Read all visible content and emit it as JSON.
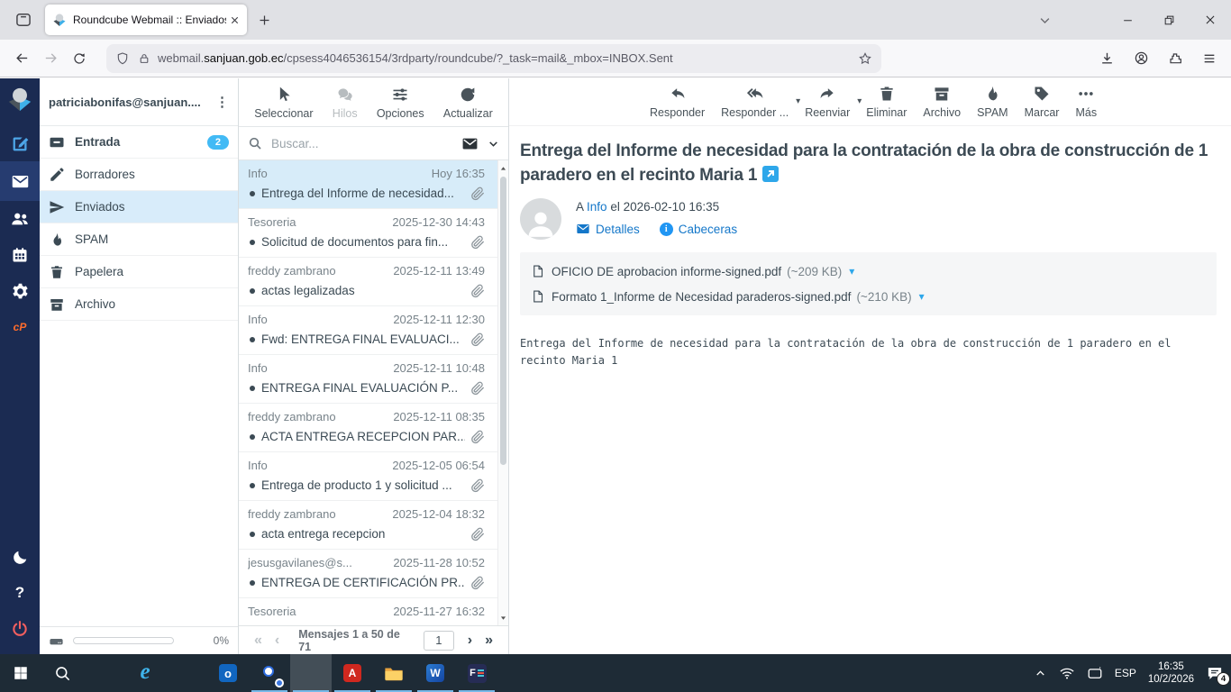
{
  "browser": {
    "tab_title": "Roundcube Webmail :: Enviados",
    "url_host_prefix": "webmail.",
    "url_domain": "sanjuan.gob.ec",
    "url_path": "/cpsess4046536154/3rdparty/roundcube/?_task=mail&_mbox=INBOX.Sent"
  },
  "account": {
    "email": "patriciabonifas@sanjuan...."
  },
  "folders": [
    {
      "label": "Entrada",
      "icon": "inbox",
      "badge": "2",
      "bold": true
    },
    {
      "label": "Borradores",
      "icon": "pencil"
    },
    {
      "label": "Enviados",
      "icon": "send",
      "selected": true
    },
    {
      "label": "SPAM",
      "icon": "flame"
    },
    {
      "label": "Papelera",
      "icon": "trash"
    },
    {
      "label": "Archivo",
      "icon": "archive"
    }
  ],
  "quota": {
    "percent": "0%"
  },
  "list_toolbar": [
    {
      "label": "Seleccionar",
      "icon": "pointer"
    },
    {
      "label": "Hilos",
      "icon": "chat",
      "disabled": true
    },
    {
      "label": "Opciones",
      "icon": "sliders"
    },
    {
      "label": "Actualizar",
      "icon": "refresh"
    }
  ],
  "search": {
    "placeholder": "Buscar..."
  },
  "messages": [
    {
      "sender": "Info",
      "date": "Hoy 16:35",
      "subject": "Entrega del Informe de necesidad...",
      "attachment": true,
      "selected": true
    },
    {
      "sender": "Tesoreria",
      "date": "2025-12-30 14:43",
      "subject": "Solicitud de documentos para fin...",
      "attachment": true
    },
    {
      "sender": "freddy zambrano",
      "date": "2025-12-11 13:49",
      "subject": "actas legalizadas",
      "attachment": true
    },
    {
      "sender": "Info",
      "date": "2025-12-11 12:30",
      "subject": "Fwd: ENTREGA FINAL EVALUACI...",
      "attachment": true
    },
    {
      "sender": "Info",
      "date": "2025-12-11 10:48",
      "subject": "ENTREGA FINAL EVALUACIÓN P...",
      "attachment": true
    },
    {
      "sender": "freddy zambrano",
      "date": "2025-12-11 08:35",
      "subject": "ACTA ENTREGA RECEPCION PAR...",
      "attachment": true
    },
    {
      "sender": "Info",
      "date": "2025-12-05 06:54",
      "subject": "Entrega de producto 1 y solicitud ...",
      "attachment": true
    },
    {
      "sender": "freddy zambrano",
      "date": "2025-12-04 18:32",
      "subject": "acta entrega recepcion",
      "attachment": true
    },
    {
      "sender": "jesusgavilanes@s...",
      "date": "2025-11-28 10:52",
      "subject": "ENTREGA DE CERTIFICACIÓN PR...",
      "attachment": true
    },
    {
      "sender": "Tesoreria",
      "date": "2025-11-27 16:32"
    }
  ],
  "pager": {
    "label": "Mensajes 1 a 50 de 71",
    "page": "1"
  },
  "mail_toolbar": [
    {
      "label": "Responder",
      "icon": "reply"
    },
    {
      "label": "Responder ...",
      "icon": "replyall",
      "caret": true
    },
    {
      "label": "Reenviar",
      "icon": "forward",
      "caret": true
    },
    {
      "label": "Eliminar",
      "icon": "trash"
    },
    {
      "label": "Archivo",
      "icon": "archive"
    },
    {
      "label": "SPAM",
      "icon": "flame"
    },
    {
      "label": "Marcar",
      "icon": "tag"
    },
    {
      "label": "Más",
      "icon": "more"
    }
  ],
  "message": {
    "subject": "Entrega del Informe de necesidad para la contratación de la obra de construcción de 1 paradero en el recinto Maria 1",
    "to_prefix": "A",
    "to": "Info",
    "date_text": "el 2026-02-10 16:35",
    "details_label": "Detalles",
    "headers_label": "Cabeceras",
    "attachments": [
      {
        "name": "OFICIO DE aprobacion informe-signed.pdf",
        "size": "(~209 KB)"
      },
      {
        "name": "Formato 1_Informe de Necesidad paraderos-signed.pdf",
        "size": "(~210 KB)"
      }
    ],
    "body": "Entrega del Informe de necesidad para la contratación de la obra de construcción de 1 paradero en el recinto Maria 1"
  },
  "taskbar": {
    "apps": [
      {
        "name": "start"
      },
      {
        "name": "taskbar-search"
      },
      {
        "name": "copilot"
      },
      {
        "name": "internet-explorer"
      },
      {
        "name": "edge"
      },
      {
        "name": "outlook"
      },
      {
        "name": "chrome",
        "running": true
      },
      {
        "name": "firefox",
        "active": true,
        "running": true
      },
      {
        "name": "acrobat",
        "running": true
      },
      {
        "name": "file-explorer",
        "running": true
      },
      {
        "name": "word",
        "running": true
      },
      {
        "name": "f-app",
        "running": true
      }
    ],
    "tray": {
      "language": "ESP",
      "time": "16:35",
      "date": "10/2/2026",
      "notification_count": "4"
    }
  },
  "colors": {
    "rail_navy": "#1b2b52",
    "badge_blue": "#42baf5",
    "link_blue": "#1477c9",
    "accent_blue": "#2ea7ea",
    "selected_row": "#d7ecf9"
  }
}
